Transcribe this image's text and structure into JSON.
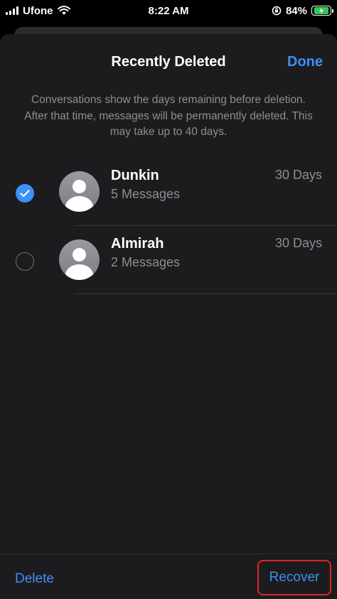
{
  "status_bar": {
    "carrier": "Ufone",
    "time": "8:22 AM",
    "battery_percent": "84%",
    "battery_level": 0.84,
    "icons": [
      "signal-icon",
      "wifi-icon",
      "orientation-lock-icon",
      "battery-charging-icon"
    ]
  },
  "sheet": {
    "title": "Recently Deleted",
    "done_label": "Done",
    "info": "Conversations show the days remaining before deletion. After that time, messages will be permanently deleted. This may take up to 40 days."
  },
  "conversations": [
    {
      "name": "Dunkin",
      "messages": "5 Messages",
      "days": "30 Days",
      "selected": true
    },
    {
      "name": "Almirah",
      "messages": "2 Messages",
      "days": "30 Days",
      "selected": false
    }
  ],
  "toolbar": {
    "delete_label": "Delete",
    "recover_label": "Recover"
  },
  "colors": {
    "accent": "#3e8ff7",
    "highlight_border": "#e0242a",
    "sheet_bg": "#1c1c1e"
  }
}
